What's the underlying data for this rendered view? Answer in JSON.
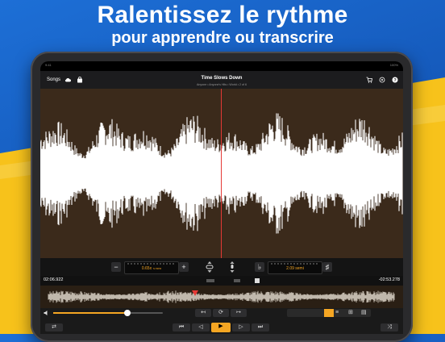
{
  "headline": {
    "line1": "Ralentissez le rythme",
    "line2": "pour apprendre ou transcrire"
  },
  "app": {
    "songs_label": "Songs",
    "track_title": "Time Slows Down",
    "track_subtitle": "Anyone • Anyone's Hits • World • 2 of 6",
    "speed_value": "0.65x",
    "speed_tempo": "72 BPM",
    "pitch_value": "2.09 semi",
    "time_elapsed": "02:06.922",
    "time_remaining": "-02:53.278",
    "volume_level": 0.68
  },
  "colors": {
    "accent": "#f5a623",
    "playhead": "#e53935",
    "waveform": "#ffffff"
  },
  "icons": {
    "cloud": "cloud-icon",
    "bag": "bag-icon",
    "cart": "cart-icon",
    "settings": "gear-icon",
    "help": "help-icon"
  }
}
